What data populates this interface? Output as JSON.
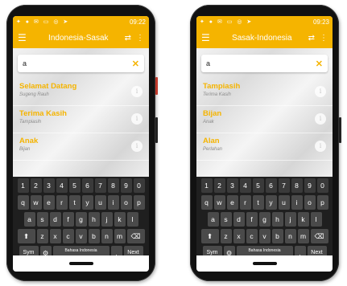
{
  "screens": [
    {
      "status_time": "09:22",
      "app_title": "Indonesia-Sasak",
      "search_value": "a",
      "results": [
        {
          "word": "Selamat Datang",
          "translation": "Sugeng Rauh"
        },
        {
          "word": "Terima Kasih",
          "translation": "Tampiasih"
        },
        {
          "word": "Anak",
          "translation": "Bijan"
        }
      ]
    },
    {
      "status_time": "09:23",
      "app_title": "Sasak-Indonesia",
      "search_value": "a",
      "results": [
        {
          "word": "Tampiasih",
          "translation": "Terima Kasih"
        },
        {
          "word": "Bijan",
          "translation": "Anak"
        },
        {
          "word": "Alan",
          "translation": "Perlahan"
        }
      ]
    }
  ],
  "keyboard": {
    "numbers": [
      "1",
      "2",
      "3",
      "4",
      "5",
      "6",
      "7",
      "8",
      "9",
      "0"
    ],
    "row1": [
      "q",
      "w",
      "e",
      "r",
      "t",
      "y",
      "u",
      "i",
      "o",
      "p"
    ],
    "row2": [
      "a",
      "s",
      "d",
      "f",
      "g",
      "h",
      "j",
      "k",
      "l"
    ],
    "row3": [
      "z",
      "x",
      "c",
      "v",
      "b",
      "n",
      "m"
    ],
    "sym_label": "Sym",
    "space_label": "Bahasa Indonesia",
    "period_label": ".",
    "next_label": "Next"
  },
  "colors": {
    "accent": "#f5b400",
    "keyboard_bg": "#1f1f1f"
  },
  "icons": {
    "menu": "hamburger-icon",
    "clear": "close-icon",
    "info": "info-icon"
  }
}
